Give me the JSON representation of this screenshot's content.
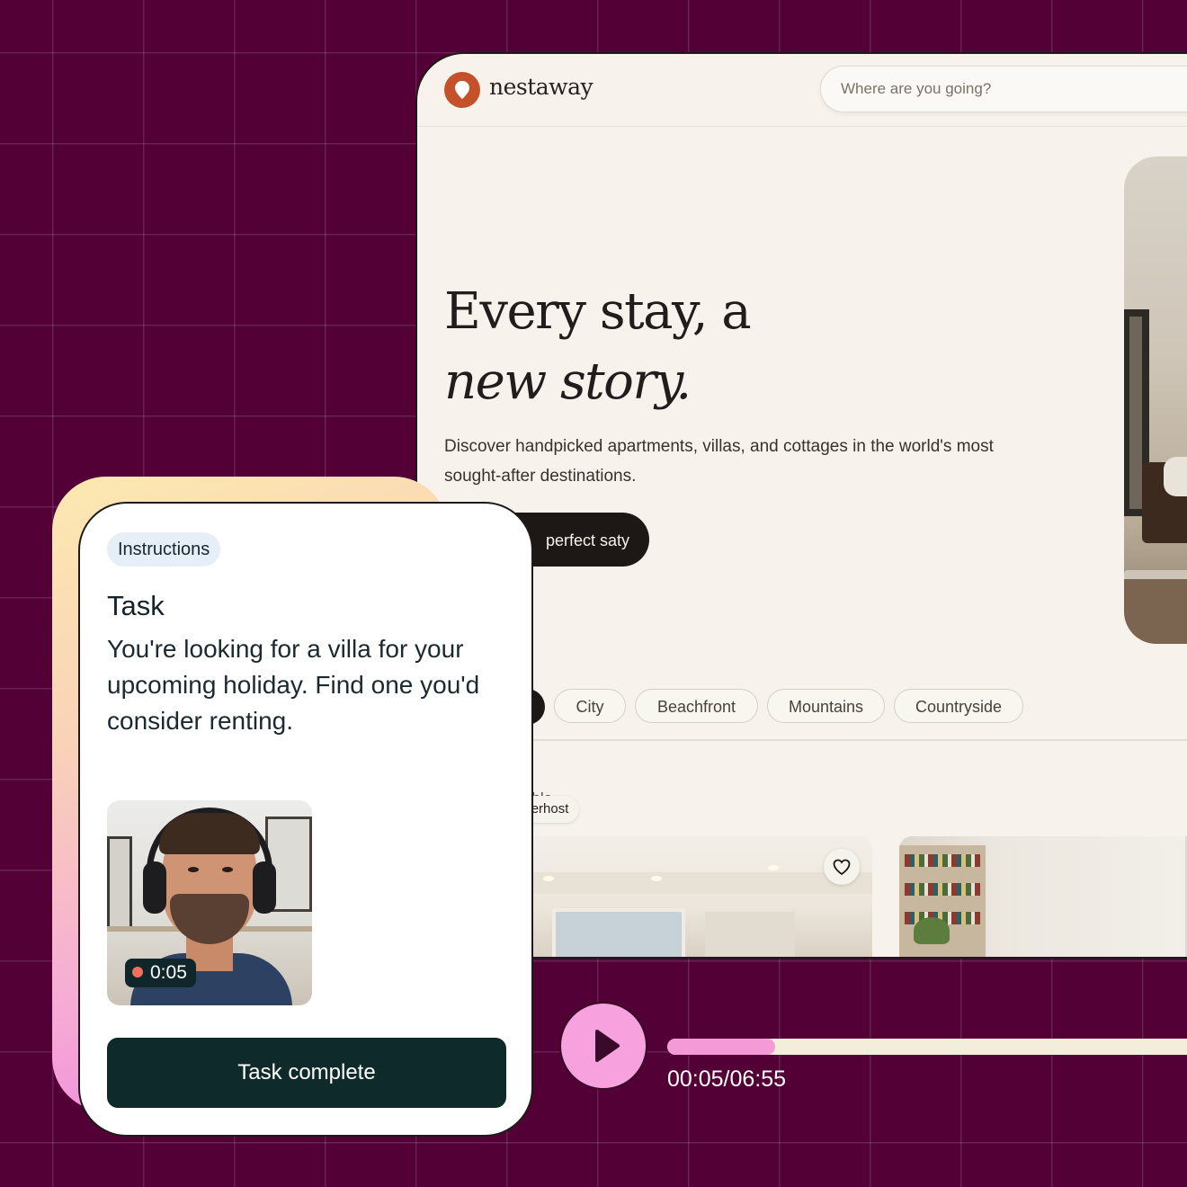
{
  "site": {
    "brand": "nestaway",
    "search_placeholder": "Where are you going?",
    "hero_title_line1": "Every stay, a",
    "hero_title_line2": "new story.",
    "hero_subtitle": "Discover handpicked apartments, villas, and cottages in the world's most sought-after destinations.",
    "cta_label": "perfect saty",
    "categories": [
      "City",
      "Beachfront",
      "Mountains",
      "Countryside"
    ],
    "section_label": "able",
    "badge": "Superhost"
  },
  "panel": {
    "tag": "Instructions",
    "title": "Task",
    "body": "You're looking for a villa for your upcoming holiday. Find one you'd consider renting.",
    "recording_time": "0:05",
    "complete_label": "Task complete"
  },
  "player": {
    "time_display": "00:05/06:55",
    "progress": 0.2
  },
  "colors": {
    "background": "#520036",
    "brand_accent": "#c4512a",
    "player_accent": "#f49ad6",
    "button_dark": "#0f2a2a"
  }
}
